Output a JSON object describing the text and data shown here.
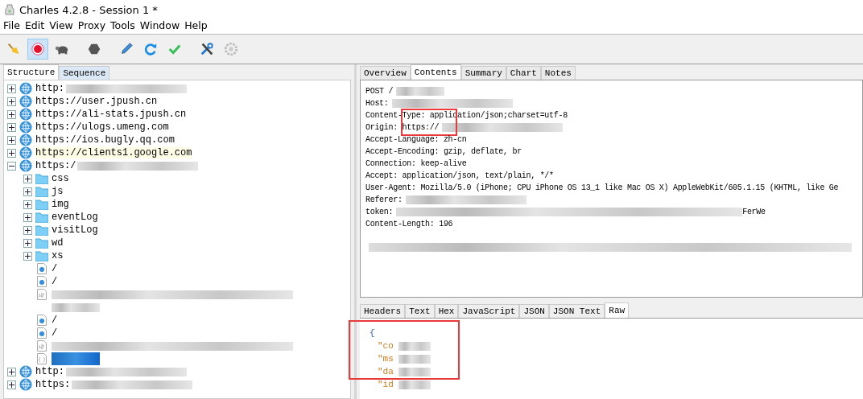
{
  "window": {
    "title": "Charles 4.2.8 - Session 1 *"
  },
  "menu": [
    "File",
    "Edit",
    "View",
    "Proxy",
    "Tools",
    "Window",
    "Help"
  ],
  "toolbar": {
    "recording": true,
    "items": [
      {
        "kind": "broom"
      },
      {
        "kind": "record"
      },
      {
        "kind": "turtle"
      },
      {
        "kind": "stop"
      },
      {
        "kind": "pen"
      },
      {
        "kind": "refresh"
      },
      {
        "kind": "check"
      },
      {
        "kind": "tools"
      },
      {
        "kind": "gear"
      }
    ]
  },
  "left_tabs": [
    {
      "label": "Structure",
      "selected": true
    },
    {
      "label": "Sequence",
      "selected": false
    }
  ],
  "tree": [
    {
      "kind": "host",
      "label": "http:",
      "redacted": true,
      "expanded": false,
      "highlighted": false,
      "selected": false
    },
    {
      "kind": "host",
      "label": "https://user.jpush.cn",
      "expanded": false,
      "highlighted": false,
      "selected": false
    },
    {
      "kind": "host",
      "label": "https://ali-stats.jpush.cn",
      "expanded": false,
      "highlighted": false,
      "selected": false
    },
    {
      "kind": "host",
      "label": "https://ulogs.umeng.com",
      "expanded": false,
      "highlighted": false,
      "selected": false
    },
    {
      "kind": "host",
      "label": "https://ios.bugly.qq.com",
      "expanded": false,
      "highlighted": false,
      "selected": false
    },
    {
      "kind": "host",
      "label": "https://clients1.google.com",
      "expanded": false,
      "highlighted": true,
      "selected": false
    },
    {
      "kind": "host",
      "label": "https:/",
      "redacted": true,
      "expanded": true,
      "highlighted": false,
      "selected": false,
      "children": [
        {
          "kind": "folder",
          "label": "css",
          "expanded": false,
          "highlighted": false,
          "selected": false
        },
        {
          "kind": "folder",
          "label": "js",
          "expanded": false,
          "highlighted": false,
          "selected": false
        },
        {
          "kind": "folder",
          "label": "img",
          "expanded": false,
          "highlighted": false,
          "selected": false
        },
        {
          "kind": "folder",
          "label": "eventLog",
          "expanded": false,
          "highlighted": false,
          "selected": false
        },
        {
          "kind": "folder",
          "label": "visitLog",
          "expanded": false,
          "highlighted": false,
          "selected": false
        },
        {
          "kind": "folder",
          "label": "wd",
          "expanded": false,
          "highlighted": false,
          "selected": false
        },
        {
          "kind": "folder",
          "label": "xs",
          "expanded": false,
          "highlighted": false,
          "selected": false
        },
        {
          "kind": "request",
          "label": "/",
          "highlighted": false,
          "selected": false
        },
        {
          "kind": "request",
          "label": "/",
          "highlighted": false,
          "selected": false
        },
        {
          "kind": "script",
          "redacted": true,
          "highlighted": false,
          "selected": false
        },
        {
          "kind": "blank",
          "redacted": true,
          "highlighted": false,
          "selected": false
        },
        {
          "kind": "request",
          "label": "/",
          "highlighted": false,
          "selected": false
        },
        {
          "kind": "request",
          "label": "/",
          "highlighted": false,
          "selected": false
        },
        {
          "kind": "script",
          "redacted": true,
          "highlighted": false,
          "selected": false
        },
        {
          "kind": "json",
          "redacted": true,
          "highlighted": false,
          "selected": true
        }
      ]
    },
    {
      "kind": "host",
      "label": "http:",
      "redacted": true,
      "expanded": false,
      "highlighted": false,
      "selected": false
    },
    {
      "kind": "host",
      "label": "https:",
      "redacted": true,
      "expanded": false,
      "highlighted": false,
      "selected": false
    }
  ],
  "right_tabs": [
    {
      "label": "Overview",
      "selected": false
    },
    {
      "label": "Contents",
      "selected": true
    },
    {
      "label": "Summary",
      "selected": false
    },
    {
      "label": "Chart",
      "selected": false
    },
    {
      "label": "Notes",
      "selected": false
    }
  ],
  "request_lines": [
    {
      "text": "POST /",
      "redacted": true
    },
    {
      "text": "Host:",
      "redacted": true
    },
    {
      "text": "Content-Type: application/json;charset=utf-8"
    },
    {
      "text": "Origin: https://",
      "redacted": true,
      "marked": true
    },
    {
      "text": "Accept-Language: zh-cn"
    },
    {
      "text": "Accept-Encoding: gzip, deflate, br"
    },
    {
      "text": "Connection: keep-alive"
    },
    {
      "text": "Accept: application/json, text/plain, */*"
    },
    {
      "text": "User-Agent: Mozilla/5.0 (iPhone; CPU iPhone OS 13_1 like Mac OS X) AppleWebKit/605.1.15 (KHTML, like Ge"
    },
    {
      "text": "Referer:",
      "redacted": true
    },
    {
      "text": "token:",
      "redacted": true,
      "tail": "FerWe"
    },
    {
      "text": "Content-Length: 196"
    },
    {
      "kind": "body",
      "redacted": true
    }
  ],
  "body_tabs": [
    {
      "label": "Headers",
      "selected": false
    },
    {
      "label": "Text",
      "selected": false
    },
    {
      "label": "Hex",
      "selected": false
    },
    {
      "label": "JavaScript",
      "selected": false
    },
    {
      "label": "JSON",
      "selected": false
    },
    {
      "label": "JSON Text",
      "selected": false
    },
    {
      "label": "Raw",
      "selected": true
    }
  ],
  "raw": {
    "marked": true,
    "lines": [
      {
        "kind": "brace",
        "text": "{"
      },
      {
        "kind": "key",
        "text": "\"co",
        "redacted": true
      },
      {
        "kind": "key",
        "text": "\"ms",
        "redacted": true
      },
      {
        "kind": "key",
        "text": "\"da",
        "redacted": true
      },
      {
        "kind": "key",
        "text": "\"id",
        "redacted": true
      }
    ]
  }
}
